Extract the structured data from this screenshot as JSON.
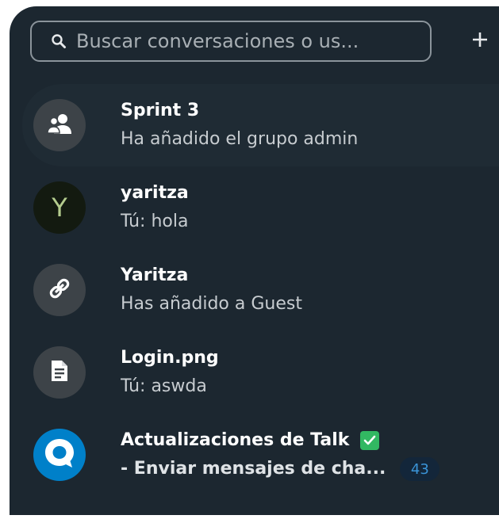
{
  "search": {
    "placeholder": "Buscar conversaciones o us...",
    "icon": "search-icon"
  },
  "actions": {
    "add_icon": "plus-icon"
  },
  "conversations": [
    {
      "title": "Sprint 3",
      "subtitle": "Ha añadido el grupo admin",
      "avatar_icon": "group-icon",
      "active": true
    },
    {
      "title": "yaritza",
      "subtitle": "Tú: hola",
      "avatar_letter": "Y"
    },
    {
      "title": "Yaritza",
      "subtitle": "Has añadido a Guest",
      "avatar_icon": "link-icon"
    },
    {
      "title": "Login.png",
      "subtitle": "Tú: aswda",
      "avatar_icon": "file-icon"
    },
    {
      "title": "Actualizaciones de Talk",
      "title_badge_icon": "check-icon",
      "subtitle": "- Enviar mensajes de cha...",
      "avatar_icon": "talk-logo-icon",
      "unread_count": "43"
    }
  ],
  "colors": {
    "panel_background": "#1c2730",
    "talk_blue": "#0080c9",
    "check_green": "#32b862",
    "unread_text": "#3a94d8"
  }
}
